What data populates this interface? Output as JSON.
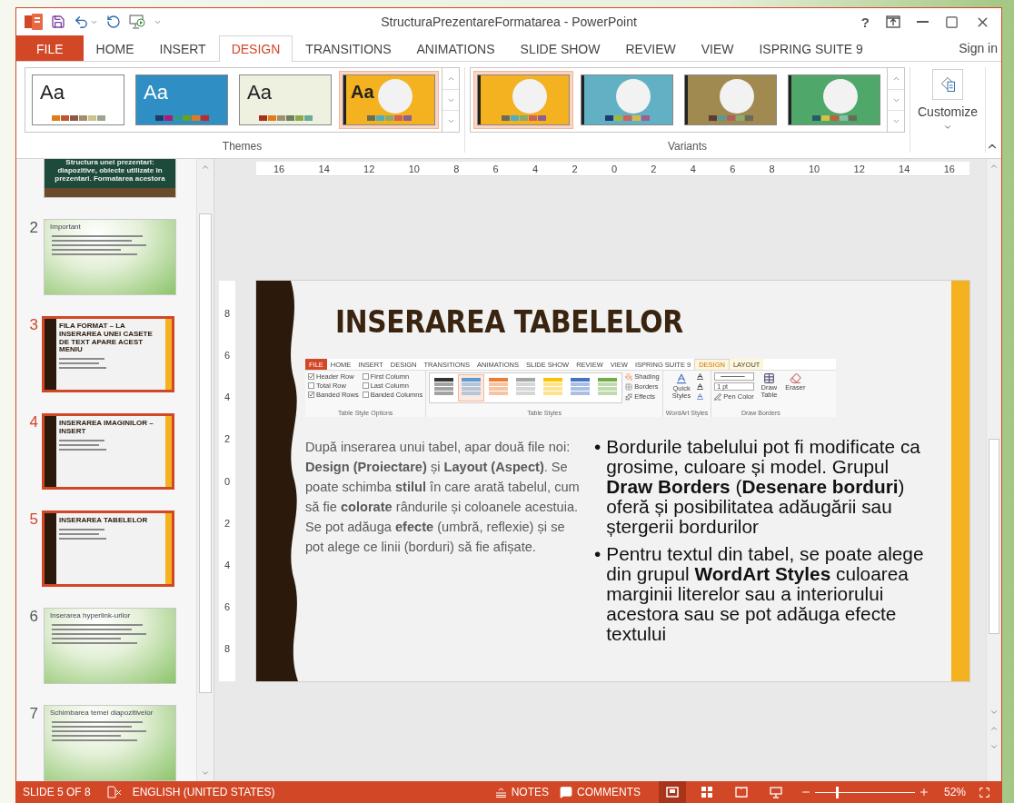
{
  "window": {
    "title": "StructuraPrezentareFormatarea - PowerPoint",
    "help": "?"
  },
  "tabs": [
    {
      "label": "FILE",
      "kind": "file",
      "selected": false
    },
    {
      "label": "HOME",
      "kind": "normal",
      "selected": false
    },
    {
      "label": "INSERT",
      "kind": "normal",
      "selected": false
    },
    {
      "label": "DESIGN",
      "kind": "normal",
      "selected": true
    },
    {
      "label": "TRANSITIONS",
      "kind": "normal",
      "selected": false
    },
    {
      "label": "ANIMATIONS",
      "kind": "normal",
      "selected": false
    },
    {
      "label": "SLIDE SHOW",
      "kind": "normal",
      "selected": false
    },
    {
      "label": "REVIEW",
      "kind": "normal",
      "selected": false
    },
    {
      "label": "VIEW",
      "kind": "normal",
      "selected": false
    },
    {
      "label": "ISPRING SUITE 9",
      "kind": "normal",
      "selected": false
    }
  ],
  "sign_in": "Sign in",
  "ribbon": {
    "themes": {
      "label": "Themes",
      "items": [
        {
          "kind": "text",
          "sample": "Aa",
          "color": "#ffffff",
          "selected": false
        },
        {
          "kind": "text",
          "sample": "Aa",
          "color": "#2f8fc4",
          "selected": false
        },
        {
          "kind": "text",
          "sample": "Aa",
          "color": "#eef0e0",
          "selected": false
        },
        {
          "kind": "badge",
          "sample": "Aa",
          "color": "#f4b120",
          "selected": true
        }
      ]
    },
    "variants": {
      "label": "Variants",
      "items": [
        {
          "kind": "badge",
          "color": "#f4b120",
          "selected": true
        },
        {
          "kind": "badge",
          "color": "#62b0c4",
          "selected": false
        },
        {
          "kind": "badge",
          "color": "#a08a50",
          "selected": false
        },
        {
          "kind": "badge",
          "color": "#4fa86a",
          "selected": false
        }
      ]
    },
    "customize": "Customize"
  },
  "thumbnails": [
    {
      "kind": "chalkboard",
      "title": "Structura unei prezentari: diapozitive, obiecte utilizate în prezentari. Formatarea acestora",
      "selected": false
    },
    {
      "number": "2",
      "kind": "green",
      "title": "Important",
      "selected": false
    },
    {
      "number": "3",
      "kind": "orange",
      "title": "FILA FORMAT – LA INSERAREA UNEI CASETE DE TEXT APARE ACEST MENIU",
      "selected": true
    },
    {
      "number": "4",
      "kind": "orange",
      "title": "INSERAREA IMAGINILOR – INSERT",
      "selected": true
    },
    {
      "number": "5",
      "kind": "orange",
      "title": "INSERAREA TABELELOR",
      "selected": true
    },
    {
      "number": "6",
      "kind": "green",
      "title": "Inserarea hyperlink-urilor",
      "selected": false
    },
    {
      "number": "7",
      "kind": "green",
      "title": "Schimbarea temei diapozitivelor",
      "selected": false
    }
  ],
  "rulers": {
    "horizontal": [
      "16",
      "14",
      "12",
      "10",
      "8",
      "6",
      "4",
      "2",
      "0",
      "2",
      "4",
      "6",
      "8",
      "10",
      "12",
      "14",
      "16"
    ],
    "vertical": [
      "8",
      "6",
      "4",
      "2",
      "0",
      "2",
      "4",
      "6",
      "8"
    ]
  },
  "slide": {
    "title": "INSERAREA TABELELOR",
    "screenshot": {
      "tabs": [
        {
          "label": "FILE",
          "kind": "file",
          "selected": false
        },
        {
          "label": "HOME",
          "kind": "normal",
          "selected": false
        },
        {
          "label": "INSERT",
          "kind": "normal",
          "selected": false
        },
        {
          "label": "DESIGN",
          "kind": "normal",
          "selected": false
        },
        {
          "label": "TRANSITIONS",
          "kind": "normal",
          "selected": false
        },
        {
          "label": "ANIMATIONS",
          "kind": "normal",
          "selected": false
        },
        {
          "label": "SLIDE SHOW",
          "kind": "normal",
          "selected": false
        },
        {
          "label": "REVIEW",
          "kind": "normal",
          "selected": false
        },
        {
          "label": "VIEW",
          "kind": "normal",
          "selected": false
        },
        {
          "label": "ISPRING SUITE 9",
          "kind": "normal",
          "selected": false
        },
        {
          "label": "DESIGN",
          "kind": "context",
          "selected": true
        },
        {
          "label": "LAYOUT",
          "kind": "context",
          "selected": false
        }
      ],
      "options": [
        {
          "label": "Header Row",
          "checked": true
        },
        {
          "label": "First Column",
          "checked": false
        },
        {
          "label": "Total Row",
          "checked": false
        },
        {
          "label": "Last Column",
          "checked": false
        },
        {
          "label": "Banded Rows",
          "checked": true
        },
        {
          "label": "Banded Columns",
          "checked": false
        }
      ],
      "styles": [
        {
          "color": "#333333",
          "selected": false
        },
        {
          "color": "#5b9bd5",
          "selected": true
        },
        {
          "color": "#ed7d31",
          "selected": false
        },
        {
          "color": "#a5a5a5",
          "selected": false
        },
        {
          "color": "#ffc000",
          "selected": false
        },
        {
          "color": "#4472c4",
          "selected": false
        },
        {
          "color": "#70ad47",
          "selected": false
        }
      ],
      "style_buttons": [
        "Shading",
        "Borders",
        "Effects"
      ],
      "quick_styles": "Quick Styles",
      "pen_weight": "1 pt",
      "pen_color": "Pen Color",
      "draw_table": "Draw Table",
      "eraser": "Eraser",
      "groups": [
        "Table Style Options",
        "Table Styles",
        "WordArt Styles",
        "Draw Borders"
      ]
    },
    "left_text": "După inserarea unui tabel, apar două file noi: **Design (Proiectare)** și **Layout (Aspect)**. Se poate schimba **stilul** în care arată tabelul, cum să fie **colorate** rândurile și coloanele acestuia. Se pot adăuga **efecte** (umbră, reflexie) și se pot alege ce linii (borduri) să fie afișate.",
    "bullets": [
      {
        "marker": "•",
        "text": "Bordurile tabelului pot fi modificate ca grosime, culoare și model. Grupul **Draw Borders** (**Desenare borduri**) oferă și posibilitatea adăugării sau ștergerii bordurilor"
      },
      {
        "marker": "•",
        "text": "Pentru textul din tabel, se poate alege din grupul **WordArt Styles** culoarea marginii literelor sau a interiorului acestora sau se pot adăuga efecte textului"
      }
    ]
  },
  "status_bar": {
    "slide": "SLIDE 5 OF 8",
    "language": "ENGLISH (UNITED STATES)",
    "notes": "NOTES",
    "comments": "COMMENTS",
    "views": [
      {
        "kind": "normal",
        "selected": true
      },
      {
        "kind": "sorter",
        "selected": false
      },
      {
        "kind": "reading",
        "selected": false
      },
      {
        "kind": "slideshow",
        "selected": false
      }
    ],
    "zoom": {
      "level": 0.22,
      "reading": "52%"
    }
  }
}
